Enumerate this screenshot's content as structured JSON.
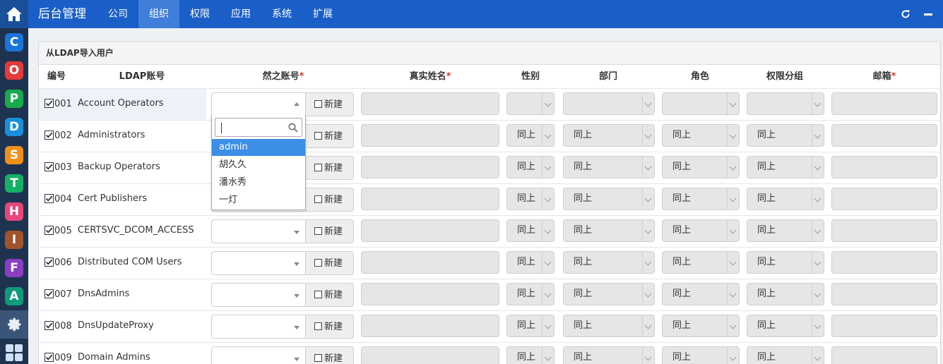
{
  "app_rail": {
    "apps": [
      {
        "letter": "C",
        "color": "#1a74d9"
      },
      {
        "letter": "O",
        "color": "#e53a3a"
      },
      {
        "letter": "P",
        "color": "#1aa94f"
      },
      {
        "letter": "D",
        "color": "#1a8fdb"
      },
      {
        "letter": "S",
        "color": "#f0901a"
      },
      {
        "letter": "T",
        "color": "#15b061"
      },
      {
        "letter": "H",
        "color": "#e8467a"
      },
      {
        "letter": "I",
        "color": "#a0542a"
      },
      {
        "letter": "F",
        "color": "#8a3fc2"
      },
      {
        "letter": "A",
        "color": "#0f9a7a"
      }
    ]
  },
  "topbar": {
    "brand": "后台管理",
    "nav": [
      "公司",
      "组织",
      "权限",
      "应用",
      "系统",
      "扩展"
    ],
    "active_nav": "组织"
  },
  "panel": {
    "title": "从LDAP导入用户",
    "columns": {
      "num": "编号",
      "ldap": "LDAP账号",
      "ranzhi": "然之账号",
      "realname": "真实姓名",
      "gender": "性别",
      "dept": "部门",
      "role": "角色",
      "group": "权限分组",
      "email": "邮箱",
      "required_mark": "*"
    },
    "new_label": "新建",
    "same_label": "同上",
    "rows": [
      {
        "num": "001",
        "account": "Account Operators"
      },
      {
        "num": "002",
        "account": "Administrators"
      },
      {
        "num": "003",
        "account": "Backup Operators"
      },
      {
        "num": "004",
        "account": "Cert Publishers"
      },
      {
        "num": "005",
        "account": "CERTSVC_DCOM_ACCESS"
      },
      {
        "num": "006",
        "account": "Distributed COM Users"
      },
      {
        "num": "007",
        "account": "DnsAdmins"
      },
      {
        "num": "008",
        "account": "DnsUpdateProxy"
      },
      {
        "num": "009",
        "account": "Domain Admins"
      }
    ],
    "dropdown_options": [
      "admin",
      "胡久久",
      "潘水秀",
      "一灯"
    ],
    "dropdown_selected": "admin"
  }
}
